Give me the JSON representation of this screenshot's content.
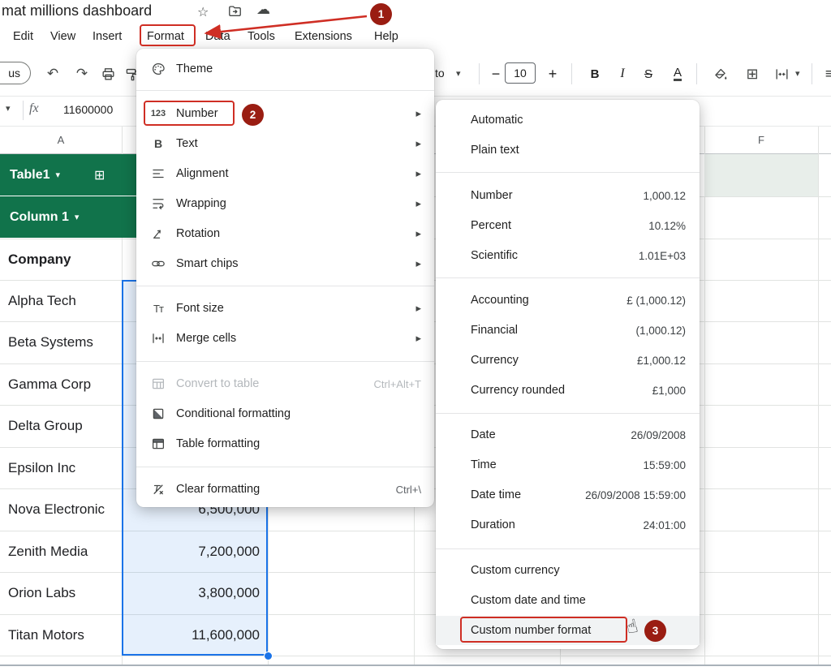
{
  "colors": {
    "annotation_red": "#cf2e24",
    "badge_red": "#9a1d12",
    "table_green": "#11734b",
    "selection_blue": "#1a73e8"
  },
  "title_bar": {
    "title": "mat millions dashboard"
  },
  "menu_bar": {
    "items": [
      "Edit",
      "View",
      "Insert",
      "Format",
      "Data",
      "Tools",
      "Extensions",
      "Help"
    ]
  },
  "toolbar": {
    "menus_pill": "us",
    "font_partial": "to",
    "minus": "−",
    "font_size_value": "10",
    "plus": "+",
    "bold": "B",
    "italic": "I",
    "strikethrough": "S",
    "text_color": "A"
  },
  "formula_bar": {
    "fx_label": "fx",
    "value": "11600000"
  },
  "icons": {
    "star": "☆",
    "cloud": "☁",
    "undo": "↶",
    "redo": "↷",
    "dropdown_caret": "▾",
    "submenu_arrow": "▸",
    "borders_grid": "⊞",
    "align_lines": "≡",
    "table_grid": "⊞",
    "table_caret": "▾",
    "number_glyph": "123",
    "text_glyph": "B",
    "font_size_glyph": "Tт",
    "hand_cursor": "☝"
  },
  "sheet": {
    "column_headers": [
      "A",
      "F"
    ],
    "table_name": "Table1",
    "table_column": "Column 1",
    "header_cell": "Company",
    "rows": [
      {
        "company": "Alpha Tech",
        "value": ""
      },
      {
        "company": "Beta Systems",
        "value": ""
      },
      {
        "company": "Gamma Corp",
        "value": ""
      },
      {
        "company": "Delta Group",
        "value": ""
      },
      {
        "company": "Epsilon Inc",
        "value": ""
      },
      {
        "company": "Nova Electronic",
        "value": "6,500,000"
      },
      {
        "company": "Zenith Media",
        "value": "7,200,000"
      },
      {
        "company": "Orion Labs",
        "value": "3,800,000"
      },
      {
        "company": "Titan Motors",
        "value": "11,600,000"
      }
    ]
  },
  "format_menu": {
    "items": [
      {
        "label": "Theme"
      },
      {
        "label": "Number"
      },
      {
        "label": "Text"
      },
      {
        "label": "Alignment"
      },
      {
        "label": "Wrapping"
      },
      {
        "label": "Rotation"
      },
      {
        "label": "Smart chips"
      },
      {
        "label": "Font size"
      },
      {
        "label": "Merge cells"
      },
      {
        "label": "Convert to table",
        "shortcut": "Ctrl+Alt+T"
      },
      {
        "label": "Conditional formatting"
      },
      {
        "label": "Table formatting"
      },
      {
        "label": "Clear formatting",
        "shortcut": "Ctrl+\\"
      }
    ]
  },
  "number_menu": {
    "items": [
      {
        "label": "Automatic",
        "example": ""
      },
      {
        "label": "Plain text",
        "example": ""
      },
      {
        "label": "Number",
        "example": "1,000.12"
      },
      {
        "label": "Percent",
        "example": "10.12%"
      },
      {
        "label": "Scientific",
        "example": "1.01E+03"
      },
      {
        "label": "Accounting",
        "example": "£ (1,000.12)"
      },
      {
        "label": "Financial",
        "example": "(1,000.12)"
      },
      {
        "label": "Currency",
        "example": "£1,000.12"
      },
      {
        "label": "Currency rounded",
        "example": "£1,000"
      },
      {
        "label": "Date",
        "example": "26/09/2008"
      },
      {
        "label": "Time",
        "example": "15:59:00"
      },
      {
        "label": "Date time",
        "example": "26/09/2008 15:59:00"
      },
      {
        "label": "Duration",
        "example": "24:01:00"
      },
      {
        "label": "Custom currency",
        "example": ""
      },
      {
        "label": "Custom date and time",
        "example": ""
      },
      {
        "label": "Custom number format",
        "example": ""
      }
    ]
  },
  "annotations": {
    "badge1": "1",
    "badge2": "2",
    "badge3": "3"
  }
}
